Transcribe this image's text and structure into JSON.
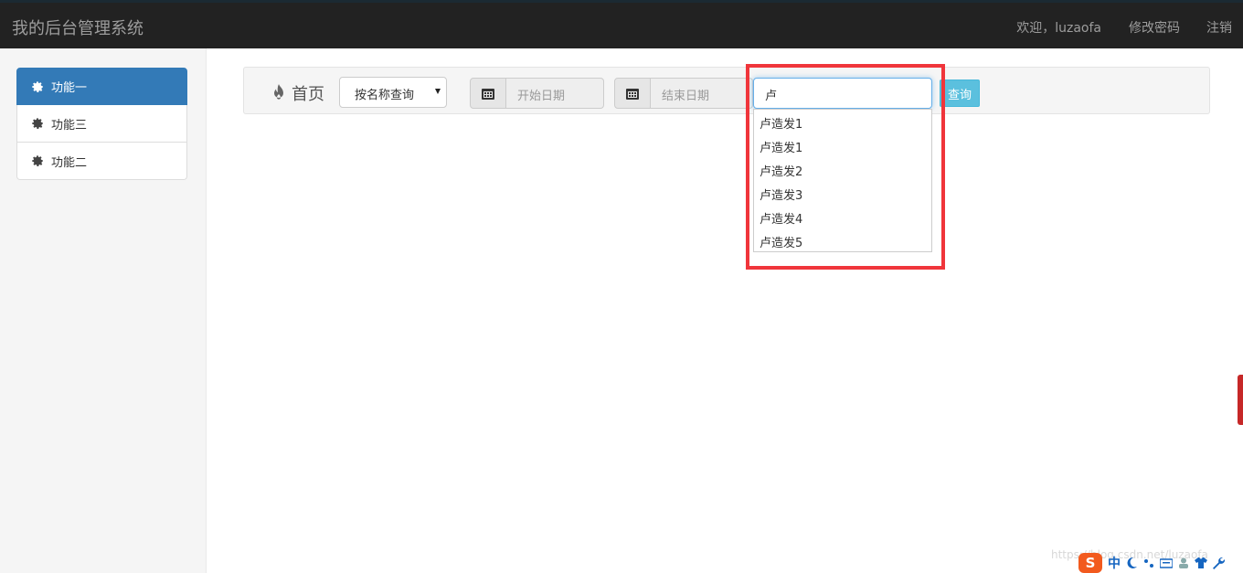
{
  "app": {
    "title": "我的后台管理系统"
  },
  "nav": {
    "welcome": "欢迎，luzaofa",
    "change_password": "修改密码",
    "logout": "注销"
  },
  "sidebar": {
    "items": [
      {
        "label": "功能一",
        "active": true
      },
      {
        "label": "功能三",
        "active": false
      },
      {
        "label": "功能二",
        "active": false
      }
    ]
  },
  "toolbar": {
    "home_label": "首页",
    "query_type": {
      "selected": "按名称查询"
    },
    "start_date": {
      "placeholder": "开始日期"
    },
    "end_date": {
      "placeholder": "结束日期"
    },
    "search": {
      "value": "卢"
    },
    "query_button": "查询"
  },
  "autocomplete": {
    "items": [
      "卢造发1",
      "卢造发1",
      "卢造发2",
      "卢造发3",
      "卢造发4",
      "卢造发5"
    ]
  },
  "watermark": "https://blog.csdn.net/luzaofa",
  "ime": {
    "logo": "S",
    "mode": "中"
  },
  "colors": {
    "accent": "#337ab7",
    "highlight": "#f0353b",
    "query_button": "#5bc0de",
    "navbar": "#222222"
  }
}
